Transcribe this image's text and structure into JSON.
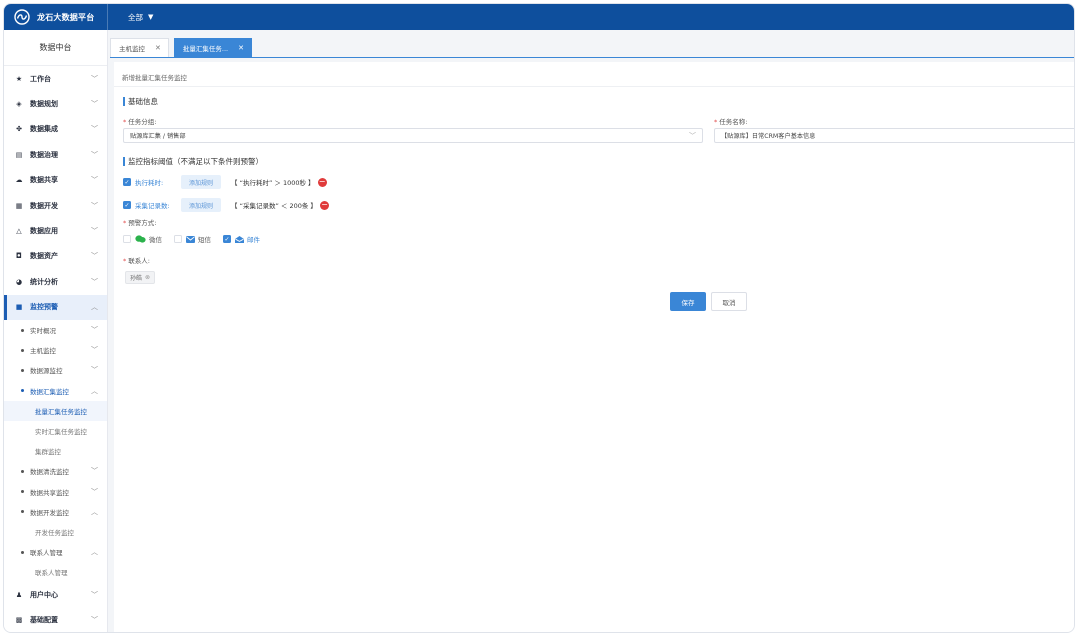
{
  "app": {
    "title": "龙石大数据平台",
    "scope_label": "全部"
  },
  "sidebar": {
    "header": "数据中台",
    "items": [
      {
        "label": "工作台"
      },
      {
        "label": "数据规划"
      },
      {
        "label": "数据集成"
      },
      {
        "label": "数据治理"
      },
      {
        "label": "数据共享"
      },
      {
        "label": "数据开发"
      },
      {
        "label": "数据应用"
      },
      {
        "label": "数据资产"
      },
      {
        "label": "统计分析"
      },
      {
        "label": "监控预警"
      },
      {
        "label": "用户中心"
      },
      {
        "label": "基础配置"
      }
    ],
    "monitor_children": [
      {
        "label": "实时概况"
      },
      {
        "label": "主机监控"
      },
      {
        "label": "数据源监控"
      },
      {
        "label": "数据汇集监控"
      },
      {
        "label": "批量汇集任务监控"
      },
      {
        "label": "实时汇集任务监控"
      },
      {
        "label": "集群监控"
      },
      {
        "label": "数据清洗监控"
      },
      {
        "label": "数据共享监控"
      },
      {
        "label": "数据开发监控"
      },
      {
        "label": "开发任务监控"
      },
      {
        "label": "联系人管理"
      },
      {
        "label": "联系人管理"
      }
    ]
  },
  "tabs": [
    {
      "label": "主机监控"
    },
    {
      "label": "批量汇集任务..."
    }
  ],
  "form": {
    "page_title": "新增批量汇集任务监控",
    "section_basic": "基础信息",
    "group_label": "任务分组:",
    "group_value": "贴源库汇集 / 销售部",
    "name_label": "任务名称:",
    "name_value": "【贴源库】日常CRM客户基本信息",
    "section_threshold": "监控指标阈值（不满足以下条件则预警）",
    "rules": [
      {
        "name": "执行耗时:",
        "add": "添加规则",
        "text": "【 “执行耗时” ＞ 1000秒 】"
      },
      {
        "name": "采集记录数:",
        "add": "添加规则",
        "text": "【 “采集记录数” ＜ 200条 】"
      }
    ],
    "notify_label": "预警方式:",
    "notify_options": {
      "wechat": "微信",
      "sms": "短信",
      "email": "邮件"
    },
    "contact_label": "联系人:",
    "contact_tag": "孙皓",
    "save": "保存",
    "cancel": "取消"
  },
  "colors": {
    "topbar": "#0e4f9d",
    "accent": "#3a86d6",
    "danger": "#e03b3b",
    "wechat": "#2bb24c"
  }
}
